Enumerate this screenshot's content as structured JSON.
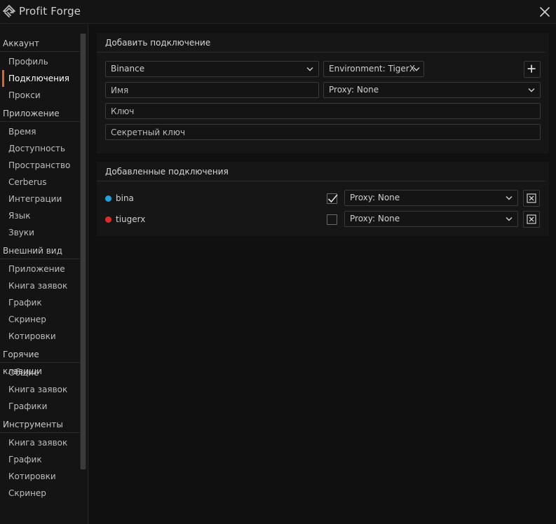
{
  "app": {
    "title": "Profit Forge"
  },
  "sidebar": {
    "sections": [
      {
        "title": "Аккаунт",
        "items": [
          "Профиль",
          "Подключения",
          "Прокси"
        ]
      },
      {
        "title": "Приложение",
        "items": [
          "Время",
          "Доступность",
          "Пространство",
          "Cerberus",
          "Интеграции",
          "Язык",
          "Звуки"
        ]
      },
      {
        "title": "Внешний вид",
        "items": [
          "Приложение",
          "Книга заявок",
          "График",
          "Скринер",
          "Котировки"
        ]
      },
      {
        "title": "Горячие клавиши",
        "items": [
          "Общие",
          "Книга заявок",
          "Графики"
        ]
      },
      {
        "title": "Инструменты",
        "items": [
          "Книга заявок",
          "График",
          "Котировки",
          "Скринер"
        ]
      }
    ],
    "active_item": "Подключения",
    "accent_color": "#e0622f"
  },
  "add_connection": {
    "title": "Добавить подключение",
    "exchange_select": "Binance",
    "environment_select": "Environment: TigerX",
    "name_placeholder": "Имя",
    "proxy_select": "Proxy: None",
    "key_placeholder": "Ключ",
    "secret_placeholder": "Секретный ключ",
    "add_icon": "plus-icon"
  },
  "added_connections": {
    "title": "Добавленные подключения",
    "rows": [
      {
        "name": "bina",
        "status_color": "#1fa3e0",
        "checked": true,
        "proxy": "Proxy: None",
        "delete_icon": "delete-box-icon"
      },
      {
        "name": "tiugerx",
        "status_color": "#e02b2b",
        "checked": false,
        "proxy": "Proxy: None",
        "delete_icon": "delete-box-icon"
      }
    ]
  }
}
